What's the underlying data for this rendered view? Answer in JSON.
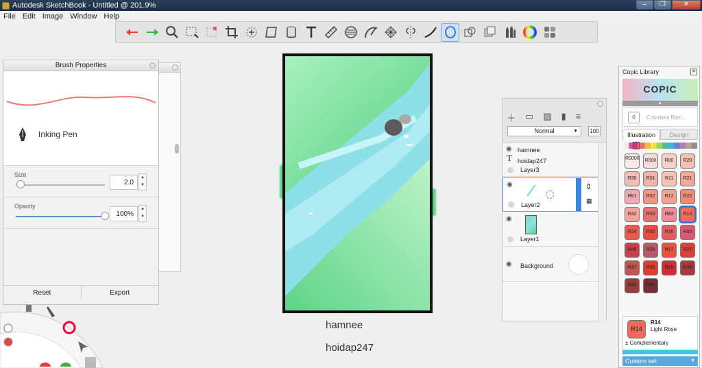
{
  "window": {
    "title": "Autodesk SketchBook - Untitled @ 201.9%",
    "minimize": "–",
    "restore": "❐",
    "close": "✕"
  },
  "menu": [
    "File",
    "Edit",
    "Image",
    "Window",
    "Help"
  ],
  "toolbar": {
    "tools": [
      "undo",
      "redo",
      "zoom",
      "select-rect",
      "select-magic",
      "crop",
      "transform",
      "distort",
      "fill-bucket",
      "text",
      "ruler",
      "ellipse-guide",
      "french-curve",
      "perspective",
      "symmetry",
      "stroke-style",
      "lasso-fill",
      "copy-paste",
      "brush-library",
      "brushes-set",
      "color-wheel",
      "copic-library"
    ]
  },
  "brush_panel": {
    "title": "Brush Properties",
    "brush_name": "Inking Pen",
    "size_label": "Size",
    "size_value": "2.0",
    "size_level": 0.05,
    "opacity_label": "Opacity",
    "opacity_value": "100%",
    "opacity_level": 1.0,
    "reset_label": "Reset",
    "export_label": "Export"
  },
  "canvas": {
    "texts": [
      "hamnee",
      "hoidap247"
    ],
    "colors": {
      "grass": "#5fd48a",
      "water": "#88e0e6",
      "light_water": "#b6eef4",
      "rock": "#5a5a5a"
    }
  },
  "layers_panel": {
    "blend_mode": "Normal",
    "opacity": "100",
    "layers": [
      {
        "text_lines": [
          "hamnee",
          "hoidap247"
        ],
        "name": "Layer3"
      },
      {
        "name": "Layer2",
        "selected": true
      },
      {
        "name": "Layer1"
      },
      {
        "name": "Background"
      }
    ]
  },
  "copic_panel": {
    "title": "Copic Library",
    "logo": "COPIC",
    "colorless_chip": "0",
    "colorless_label": "Colorless Blen...",
    "tabs": [
      "Illustration",
      "Design"
    ],
    "active_tab": "Illustration",
    "swatches": [
      {
        "code": "R0000",
        "color": "#fbe9e6"
      },
      {
        "code": "R000",
        "color": "#f9dedb"
      },
      {
        "code": "R00",
        "color": "#f7d0c8"
      },
      {
        "code": "R20",
        "color": "#f6c0b2"
      },
      {
        "code": "R30",
        "color": "#f4bcb4"
      },
      {
        "code": "R01",
        "color": "#f3b4a8"
      },
      {
        "code": "R11",
        "color": "#f6c2b5"
      },
      {
        "code": "R21",
        "color": "#f3a897"
      },
      {
        "code": "R81",
        "color": "#f2a9b6"
      },
      {
        "code": "R02",
        "color": "#f29486"
      },
      {
        "code": "R12",
        "color": "#f2a392"
      },
      {
        "code": "R22",
        "color": "#ef8b79"
      },
      {
        "code": "R32",
        "color": "#f4a39a"
      },
      {
        "code": "R43",
        "color": "#e66f6f"
      },
      {
        "code": "R83",
        "color": "#ef8a9a"
      },
      {
        "code": "R14",
        "color": "#ee6a5b"
      },
      {
        "code": "R24",
        "color": "#e85a4e"
      },
      {
        "code": "R05",
        "color": "#e84d3f"
      },
      {
        "code": "R35",
        "color": "#e06060"
      },
      {
        "code": "R85",
        "color": "#d65a74"
      },
      {
        "code": "R46",
        "color": "#c9404c"
      },
      {
        "code": "R56",
        "color": "#b75a68"
      },
      {
        "code": "R17",
        "color": "#e2553f"
      },
      {
        "code": "R27",
        "color": "#d9403a"
      },
      {
        "code": "R37",
        "color": "#c4554e"
      },
      {
        "code": "R08",
        "color": "#e23e2f"
      },
      {
        "code": "R29",
        "color": "#cf2f33"
      },
      {
        "code": "R39",
        "color": "#a83a3f"
      },
      {
        "code": "R59",
        "color": "#9a3c3c"
      },
      {
        "code": "R89",
        "color": "#7c2b32"
      }
    ],
    "selected_code": "R14",
    "current": {
      "code": "R14",
      "name": "Light Rose",
      "color": "#ee6a5b"
    },
    "complementary_label": "± Complementary",
    "complementary_color": "#44c6e0",
    "custom_set_label": "Custom set"
  }
}
